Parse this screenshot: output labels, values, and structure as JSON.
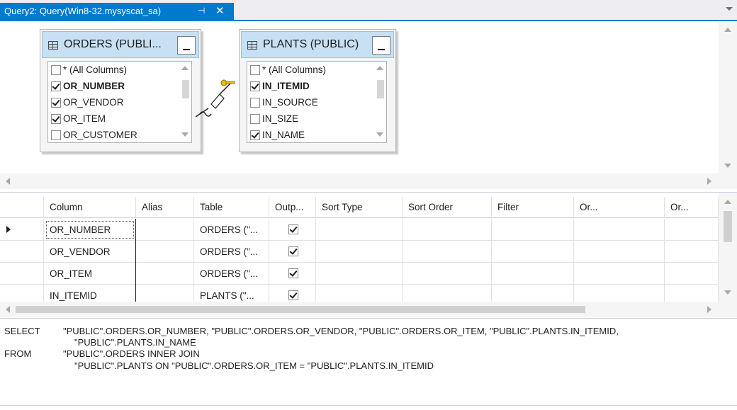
{
  "tab": {
    "title": "Query2: Query(Win8-32.mysyscat_sa)",
    "pin_glyph": "⊣",
    "close_glyph": "✕"
  },
  "diagram": {
    "tables": [
      {
        "name": "ORDERS (PUBLI...",
        "columns": [
          {
            "label": "* (All Columns)",
            "checked": false,
            "bold": false
          },
          {
            "label": "OR_NUMBER",
            "checked": true,
            "bold": true
          },
          {
            "label": "OR_VENDOR",
            "checked": true,
            "bold": false
          },
          {
            "label": "OR_ITEM",
            "checked": true,
            "bold": false
          },
          {
            "label": "OR_CUSTOMER",
            "checked": false,
            "bold": false
          }
        ]
      },
      {
        "name": "PLANTS (PUBLIC)",
        "columns": [
          {
            "label": "* (All Columns)",
            "checked": false,
            "bold": false
          },
          {
            "label": "IN_ITEMID",
            "checked": true,
            "bold": true
          },
          {
            "label": "IN_SOURCE",
            "checked": false,
            "bold": false
          },
          {
            "label": "IN_SIZE",
            "checked": false,
            "bold": false
          },
          {
            "label": "IN_NAME",
            "checked": true,
            "bold": false
          }
        ]
      }
    ],
    "join_icon": "key-join-icon"
  },
  "grid": {
    "headers": [
      "Column",
      "Alias",
      "Table",
      "Outp...",
      "Sort Type",
      "Sort Order",
      "Filter",
      "Or...",
      "Or..."
    ],
    "rows": [
      {
        "column": "OR_NUMBER",
        "alias": "",
        "table": "ORDERS (\"...",
        "output": true,
        "current": true
      },
      {
        "column": "OR_VENDOR",
        "alias": "",
        "table": "ORDERS (\"...",
        "output": true,
        "current": false
      },
      {
        "column": "OR_ITEM",
        "alias": "",
        "table": "ORDERS (\"...",
        "output": true,
        "current": false
      },
      {
        "column": "IN_ITEMID",
        "alias": "",
        "table": "PLANTS (\"...",
        "output": true,
        "current": false
      }
    ]
  },
  "sql": {
    "select_keyword": "SELECT",
    "select_line1": "\"PUBLIC\".ORDERS.OR_NUMBER, \"PUBLIC\".ORDERS.OR_VENDOR, \"PUBLIC\".ORDERS.OR_ITEM, \"PUBLIC\".PLANTS.IN_ITEMID,",
    "select_line2": "\"PUBLIC\".PLANTS.IN_NAME",
    "from_keyword": "FROM",
    "from_line1": "\"PUBLIC\".ORDERS INNER JOIN",
    "from_line2": "\"PUBLIC\".PLANTS ON \"PUBLIC\".ORDERS.OR_ITEM = \"PUBLIC\".PLANTS.IN_ITEMID"
  },
  "colors": {
    "accent": "#007acc",
    "title_bar": "#c7e0f4",
    "join_key": "#e8c000"
  }
}
